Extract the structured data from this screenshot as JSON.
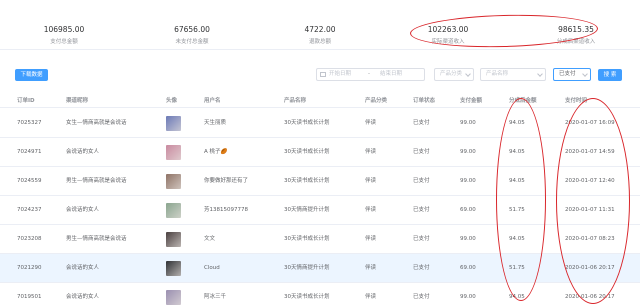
{
  "stats": [
    {
      "value": "106985.00",
      "label": "支付总金额"
    },
    {
      "value": "67656.00",
      "label": "未支付总金额"
    },
    {
      "value": "4722.00",
      "label": "退款总额"
    },
    {
      "value": "102263.00",
      "label": "实际渠道收入"
    },
    {
      "value": "98615.35",
      "label": "分成后渠道收入"
    }
  ],
  "toolbar": {
    "export_label": "下载数据",
    "date_start_placeholder": "开始日期",
    "date_sep": "-",
    "date_end_placeholder": "结束日期",
    "category_placeholder": "产品分类",
    "product_placeholder": "产品名称",
    "status_value": "已支付",
    "search_label": "搜 索"
  },
  "table": {
    "headers": [
      "订单ID",
      "渠道昵称",
      "头像",
      "用户名",
      "产品名称",
      "产品分类",
      "订单状态",
      "支付金额",
      "分成后金额",
      "支付时间"
    ],
    "rows": [
      {
        "id": "7025327",
        "channel": "女生—情商高就是会说话",
        "avatar_color": "#6b79b6",
        "user": "天生丽质",
        "product": "30天读书成长计划",
        "category": "伴读",
        "status": "已支付",
        "amount": "99.00",
        "share": "94.05",
        "time": "2020-01-07 16:09"
      },
      {
        "id": "7024971",
        "channel": "会说话的女人",
        "avatar_color": "#c98aa0",
        "user": "A 桃子🏉",
        "product": "30天读书成长计划",
        "category": "伴读",
        "status": "已支付",
        "amount": "99.00",
        "share": "94.05",
        "time": "2020-01-07 14:59"
      },
      {
        "id": "7024559",
        "channel": "男生—情商高就是会说话",
        "avatar_color": "#8f7366",
        "user": "你要做好那还有了",
        "product": "30天读书成长计划",
        "category": "伴读",
        "status": "已支付",
        "amount": "99.00",
        "share": "94.05",
        "time": "2020-01-07 12:40"
      },
      {
        "id": "7024237",
        "channel": "会说话的女人",
        "avatar_color": "#8aa58f",
        "user": "芳13815097778",
        "product": "30天情商提升计划",
        "category": "伴读",
        "status": "已支付",
        "amount": "69.00",
        "share": "51.75",
        "time": "2020-01-07 11:31"
      },
      {
        "id": "7023208",
        "channel": "男生—情商高就是会说话",
        "avatar_color": "#4a4040",
        "user": "文文",
        "product": "30天读书成长计划",
        "category": "伴读",
        "status": "已支付",
        "amount": "99.00",
        "share": "94.05",
        "time": "2020-01-07 08:23"
      },
      {
        "id": "7021290",
        "channel": "会说话的女人",
        "avatar_color": "#2f3136",
        "user": "Cloud",
        "product": "30天情商提升计划",
        "category": "伴读",
        "status": "已支付",
        "amount": "69.00",
        "share": "51.75",
        "time": "2020-01-06 20:17"
      },
      {
        "id": "7019501",
        "channel": "会说话的女人",
        "avatar_color": "#9a8fb0",
        "user": "阿冰三千",
        "product": "30天读书成长计划",
        "category": "伴读",
        "status": "已支付",
        "amount": "99.00",
        "share": "94.05",
        "time": "2020-01-06 20:17"
      }
    ]
  }
}
